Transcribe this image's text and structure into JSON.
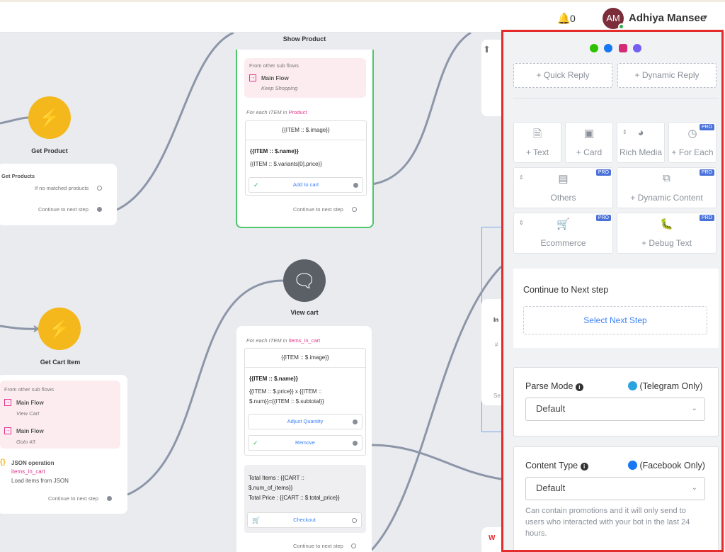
{
  "header": {
    "notification_count": "0",
    "avatar_initials": "AM",
    "user_name": "Adhiya Mansee"
  },
  "flow": {
    "get_product": {
      "title": "Get Product",
      "card_heading": "Get Products",
      "no_match": "If no matched products",
      "continue": "Continue to next step"
    },
    "show_product": {
      "title": "Show Product",
      "from_other": "From other sub flows",
      "main_flow": "Main Flow",
      "main_flow_sub": "Keep Shopping",
      "for_each": "For each ITEM in",
      "for_each_var": "Product",
      "image": "{{ITEM :: $.image}}",
      "name": "{{ITEM :: $.name}}",
      "price": "{{ITEM :: $.variants[0].price}}",
      "add_to_cart": "Add to cart",
      "continue": "Continue to next step"
    },
    "get_cart_item": {
      "title": "Get Cart Item",
      "from_other": "From other sub flows",
      "main_flow_1": "Main Flow",
      "main_flow_1_sub": "View Cart",
      "main_flow_2": "Main Flow",
      "main_flow_2_sub": "Goto #3",
      "json_op": "JSON operation",
      "json_var": "items_in_cart",
      "json_desc": "Load items from JSON",
      "continue": "Continue to next step"
    },
    "view_cart": {
      "title": "View cart",
      "for_each": "For each ITEM in",
      "for_each_var": "items_in_cart",
      "image": "{{ITEM :: $.image}}",
      "name": "{{ITEM :: $.name}}",
      "line1": "{{ITEM :: $.price}} x {{ITEM ::",
      "line2": "$.num}}={{ITEM :: $.subtotal}}",
      "adjust": "Adjust Quantity",
      "remove": "Remove",
      "total_items_1": "Total Items : {{CART ::",
      "total_items_2": "$.num_of_items}}",
      "total_price": "Total Price : {{CART :: $.total_price}}",
      "checkout": "Checkout",
      "continue": "Continue to next step"
    },
    "partial_right": {
      "label_in": "In",
      "label_hash": "#",
      "label_se": "Se"
    }
  },
  "panel": {
    "quick_reply": "+ Quick Reply",
    "dynamic_reply": "+ Dynamic Reply",
    "tools": [
      {
        "label": "+ Text",
        "icon": "document-icon",
        "pro": false
      },
      {
        "label": "+ Card",
        "icon": "card-icon",
        "pro": false
      },
      {
        "label": "Rich Media",
        "icon": "chart-icon",
        "pro": false
      },
      {
        "label": "+ For Each",
        "icon": "clock-icon",
        "pro": true
      },
      {
        "label": "Others",
        "icon": "list-icon",
        "pro": true
      },
      {
        "label": "+ Dynamic Content",
        "icon": "external-link-icon",
        "pro": true
      },
      {
        "label": "Ecommerce",
        "icon": "cart-icon",
        "pro": true
      },
      {
        "label": "+ Debug Text",
        "icon": "bug-icon",
        "pro": true
      }
    ],
    "pro_badge": "PRO",
    "continue_label": "Continue to Next step",
    "select_next": "Select Next Step",
    "parse_mode_label": "Parse Mode",
    "parse_mode_platform": "(Telegram Only)",
    "parse_mode_value": "Default",
    "content_type_label": "Content Type",
    "content_type_platform": "(Facebook Only)",
    "content_type_value": "Default",
    "content_type_help": "Can contain promotions and it will only send to users who interacted with your bot in the last 24 hours.",
    "colors": {
      "border": "#e32b2b",
      "accent": "#3b82f6",
      "pro": "#4a72d9"
    }
  }
}
